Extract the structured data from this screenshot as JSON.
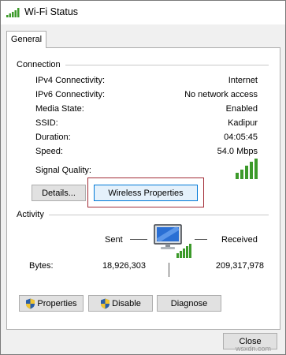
{
  "window": {
    "title": "Wi-Fi Status",
    "icon": "wifi-signal-icon"
  },
  "tabs": [
    {
      "label": "General",
      "active": true
    }
  ],
  "connection": {
    "heading": "Connection",
    "rows": [
      {
        "label": "IPv4 Connectivity:",
        "value": "Internet"
      },
      {
        "label": "IPv6 Connectivity:",
        "value": "No network access"
      },
      {
        "label": "Media State:",
        "value": "Enabled"
      },
      {
        "label": "SSID:",
        "value": "Kadipur"
      },
      {
        "label": "Duration:",
        "value": "04:05:45"
      },
      {
        "label": "Speed:",
        "value": "54.0 Mbps"
      }
    ],
    "signal_label": "Signal Quality:",
    "signal_icon": "signal-bars-icon",
    "details_button": "Details...",
    "wireless_button": "Wireless Properties"
  },
  "activity": {
    "heading": "Activity",
    "sent_label": "Sent",
    "received_label": "Received",
    "bytes_label": "Bytes:",
    "sent_bytes": "18,926,303",
    "received_bytes": "209,317,978",
    "icon": "network-computer-icon"
  },
  "buttons": {
    "properties": "Properties",
    "disable": "Disable",
    "diagnose": "Diagnose",
    "close": "Close"
  },
  "watermark": "wsxdn.com",
  "colors": {
    "signal_green": "#3c9a2a",
    "highlight_red": "#a22c36",
    "focus_blue": "#0078d7"
  }
}
